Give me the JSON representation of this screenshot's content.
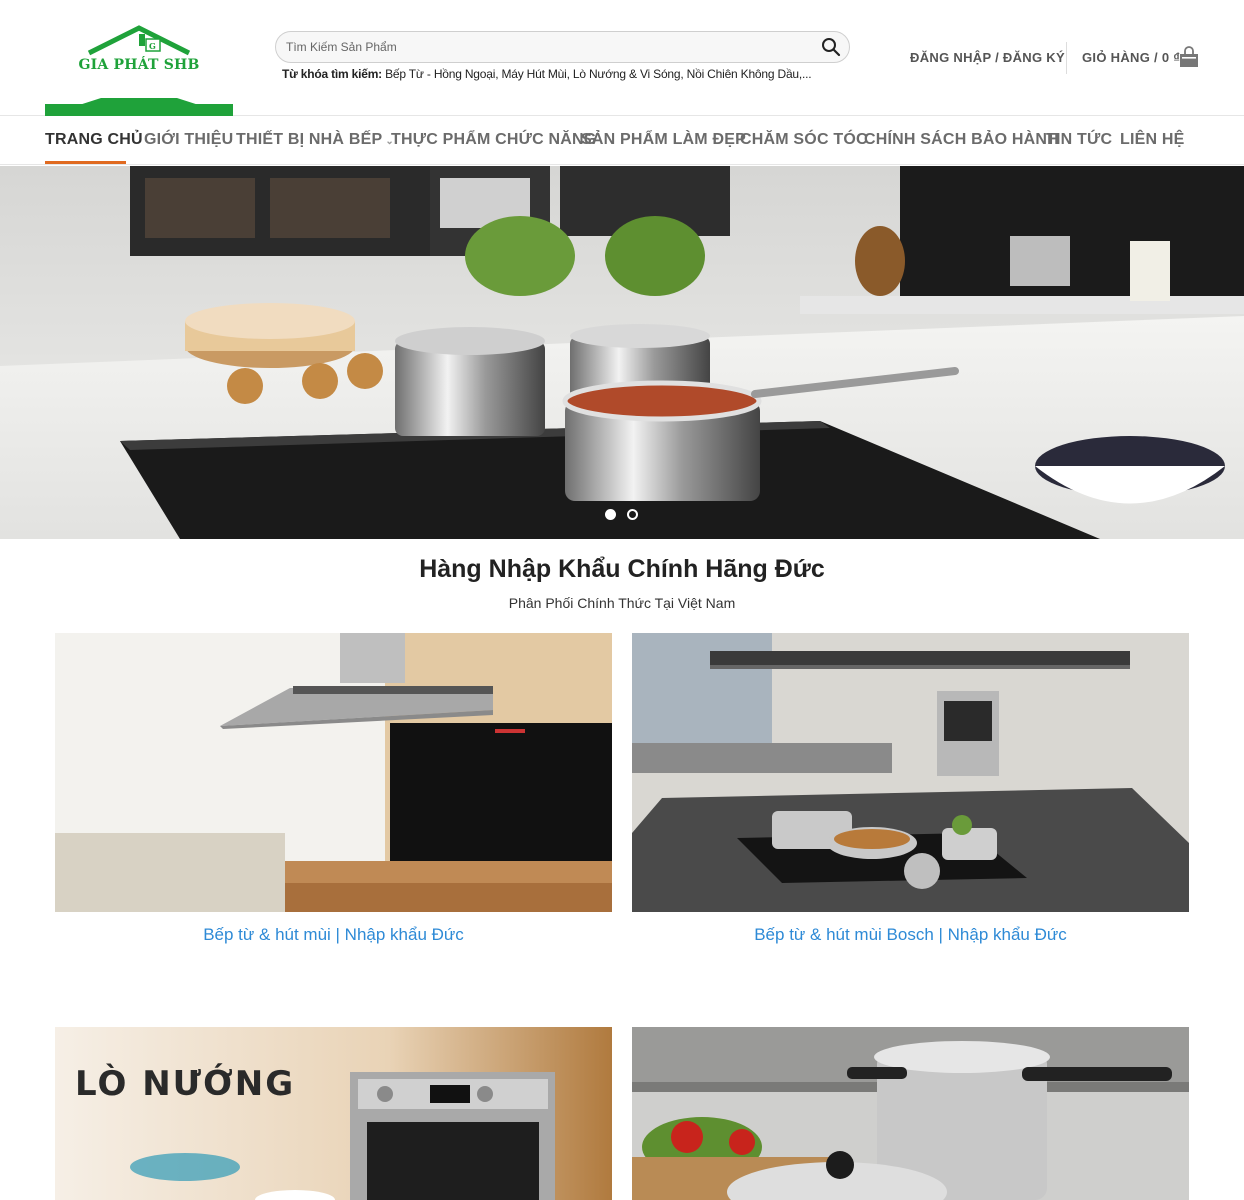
{
  "logo": {
    "text": "GIA PHÁT SHB"
  },
  "search": {
    "placeholder": "Tìm Kiếm Sản Phẩm",
    "keywords_label": "Từ khóa tìm kiếm:",
    "keywords": "Bếp Từ - Hồng Ngoại, Máy Hút Mùi, Lò Nướng & Vi Sóng, Nồi Chiên Không Dầu,..."
  },
  "account": {
    "label": "ĐĂNG NHẬP / ĐĂNG KÝ"
  },
  "cart": {
    "label": "GIỎ HÀNG / 0 ₫"
  },
  "nav": [
    {
      "label": "TRANG CHỦ"
    },
    {
      "label": "GIỚI THIỆU"
    },
    {
      "label": "THIẾT BỊ NHÀ BẾP"
    },
    {
      "label": "THỰC PHẨM CHỨC NĂNG"
    },
    {
      "label": "SẢN PHẨM LÀM ĐẸP"
    },
    {
      "label": "CHĂM SÓC TÓC"
    },
    {
      "label": "CHÍNH SÁCH BẢO HÀNH"
    },
    {
      "label": "TIN TỨC"
    },
    {
      "label": "LIÊN HỆ"
    }
  ],
  "hero": {
    "slide_count": 2,
    "active_slide": 1
  },
  "section": {
    "title": "Hàng Nhập Khẩu Chính Hãng Đức",
    "subtitle": "Phân Phối Chính Thức Tại Việt Nam"
  },
  "cards": [
    {
      "caption": "Bếp từ & hút mùi | Nhập khẩu Đức"
    },
    {
      "caption": "Bếp từ & hút mùi Bosch | Nhập khẩu Đức"
    },
    {
      "caption": "",
      "banner_text": "LÒ NƯỚNG"
    },
    {
      "caption": ""
    }
  ],
  "colors": {
    "brand_green": "#1fa23a",
    "accent_orange": "#e06a20",
    "link_blue": "#2e8ad6"
  }
}
